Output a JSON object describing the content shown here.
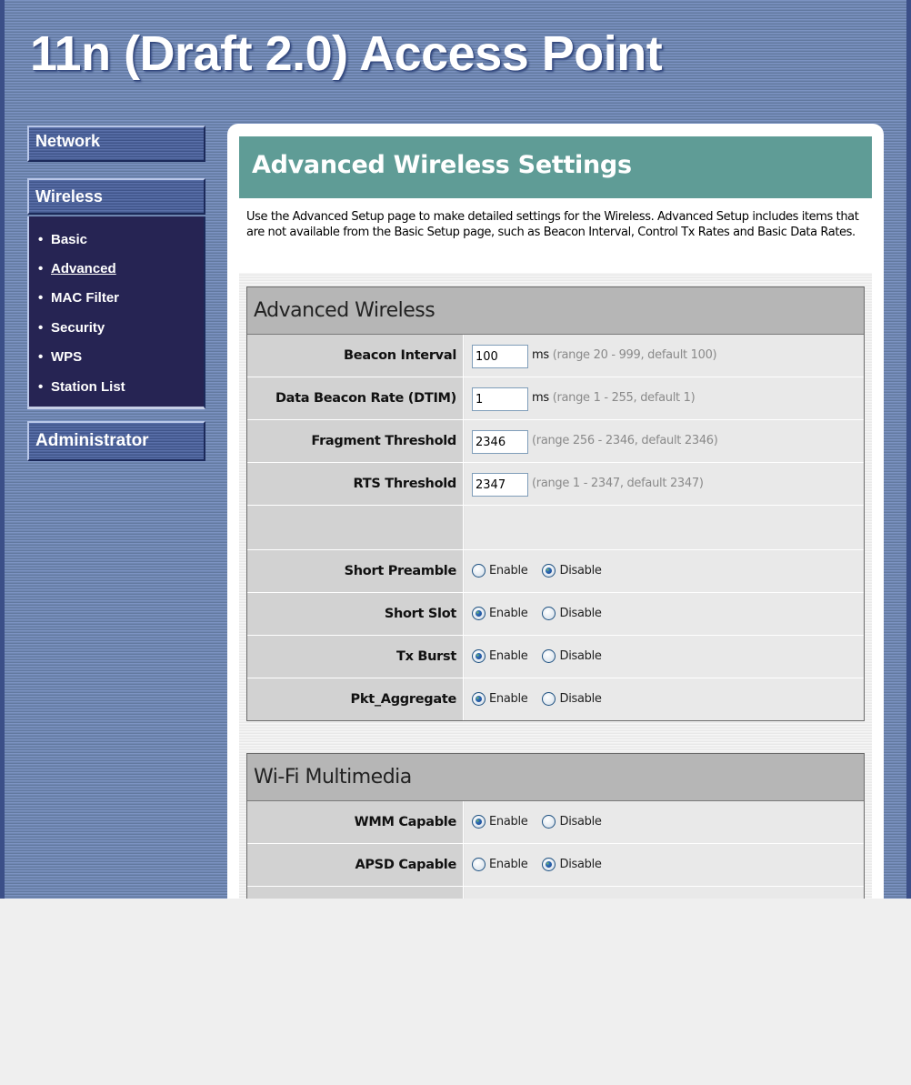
{
  "app": {
    "title": "11n (Draft 2.0) Access Point"
  },
  "sidebar": {
    "network": "Network",
    "wireless": "Wireless",
    "administrator": "Administrator",
    "wireless_items": [
      {
        "label": "Basic",
        "active": false
      },
      {
        "label": "Advanced",
        "active": true
      },
      {
        "label": "MAC Filter",
        "active": false
      },
      {
        "label": "Security",
        "active": false
      },
      {
        "label": "WPS",
        "active": false
      },
      {
        "label": "Station List",
        "active": false
      }
    ],
    "bullet": "•"
  },
  "page": {
    "title": "Advanced Wireless Settings",
    "description": "Use the Advanced Setup page to make detailed settings for the Wireless. Advanced Setup includes items that are not available from the Basic Setup page, such as Beacon Interval, Control Tx Rates and Basic Data Rates."
  },
  "advanced_wireless": {
    "heading": "Advanced Wireless",
    "beacon_interval": {
      "label": "Beacon Interval",
      "value": "100",
      "unit": "ms",
      "hint": "(range 20 - 999, default 100)"
    },
    "dtim": {
      "label": "Data Beacon Rate (DTIM)",
      "value": "1",
      "unit": "ms",
      "hint": "(range 1 - 255, default 1)"
    },
    "fragment_threshold": {
      "label": "Fragment Threshold",
      "value": "2346",
      "hint": "(range 256 - 2346, default 2346)"
    },
    "rts_threshold": {
      "label": "RTS Threshold",
      "value": "2347",
      "hint": "(range 1 - 2347, default 2347)"
    },
    "short_preamble": {
      "label": "Short Preamble",
      "enable": "Enable",
      "disable": "Disable",
      "selected": "Disable"
    },
    "short_slot": {
      "label": "Short Slot",
      "enable": "Enable",
      "disable": "Disable",
      "selected": "Enable"
    },
    "tx_burst": {
      "label": "Tx Burst",
      "enable": "Enable",
      "disable": "Disable",
      "selected": "Enable"
    },
    "pkt_aggregate": {
      "label": "Pkt_Aggregate",
      "enable": "Enable",
      "disable": "Disable",
      "selected": "Enable"
    }
  },
  "wifi_multimedia": {
    "heading": "Wi-Fi Multimedia",
    "wmm_capable": {
      "label": "WMM Capable",
      "enable": "Enable",
      "disable": "Disable",
      "selected": "Enable"
    },
    "apsd_capable": {
      "label": "APSD Capable",
      "enable": "Enable",
      "disable": "Disable",
      "selected": "Disable"
    }
  },
  "colors": {
    "background_stripe": "#6f86b6",
    "nav_dark": "#262453",
    "title_bar": "#5f9c96",
    "section_head": "#b6b6b6"
  }
}
